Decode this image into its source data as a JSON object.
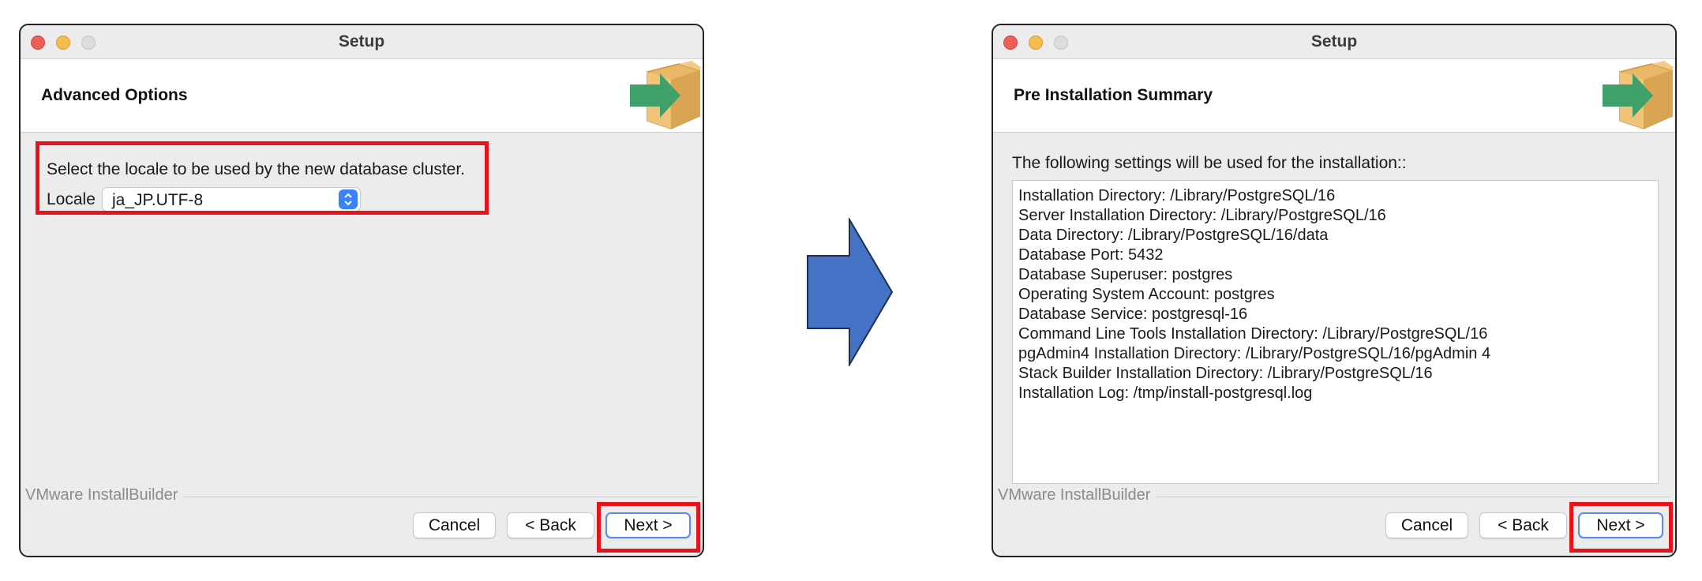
{
  "left_window": {
    "title": "Setup",
    "header_title": "Advanced Options",
    "prompt": "Select the locale to be used by the new database cluster.",
    "locale_label": "Locale",
    "locale_value": "ja_JP.UTF-8",
    "brand": "VMware InstallBuilder",
    "buttons": {
      "cancel": "Cancel",
      "back": "< Back",
      "next": "Next >"
    }
  },
  "right_window": {
    "title": "Setup",
    "header_title": "Pre Installation Summary",
    "intro": "The following settings will be used for the installation::",
    "summary_lines": [
      "Installation Directory: /Library/PostgreSQL/16",
      "Server Installation Directory: /Library/PostgreSQL/16",
      "Data Directory: /Library/PostgreSQL/16/data",
      "Database Port: 5432",
      "Database Superuser: postgres",
      "Operating System Account: postgres",
      "Database Service: postgresql-16",
      "Command Line Tools Installation Directory: /Library/PostgreSQL/16",
      "pgAdmin4 Installation Directory: /Library/PostgreSQL/16/pgAdmin 4",
      "Stack Builder Installation Directory: /Library/PostgreSQL/16",
      "Installation Log: /tmp/install-postgresql.log"
    ],
    "brand": "VMware InstallBuilder",
    "buttons": {
      "cancel": "Cancel",
      "back": "< Back",
      "next": "Next >"
    }
  },
  "colors": {
    "highlight": "#e8131a",
    "arrow_fill": "#4472c4",
    "logo_box": "#e8b866",
    "logo_arrow": "#3fa06a"
  },
  "icons": [
    "installer-box-icon",
    "select-chevron-icon",
    "flow-arrow-icon"
  ]
}
